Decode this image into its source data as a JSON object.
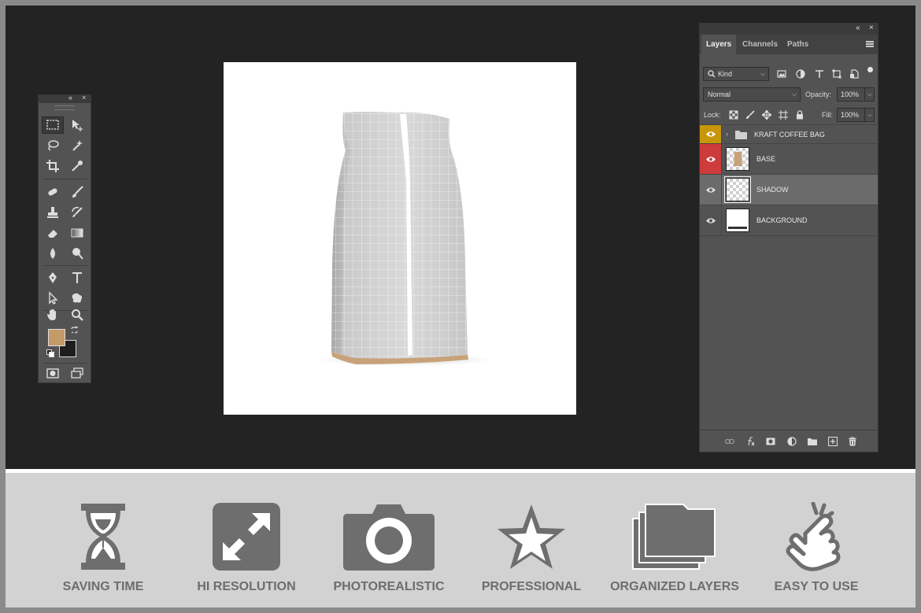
{
  "colors": {
    "workspace": "#232323",
    "panel": "#535353",
    "foreground_swatch": "#c49a66",
    "background_swatch": "#1e1e1e",
    "eye_group": "#c8960a",
    "eye_base": "#cd3b3b",
    "feature_icon": "#6e6e6e"
  },
  "tools_panel": {
    "collapse_glyph": "«",
    "close_glyph": "×"
  },
  "layers_panel": {
    "collapse_glyph": "«",
    "close_glyph": "×",
    "tabs": [
      "Layers",
      "Channels",
      "Paths"
    ],
    "filter": {
      "label": "Kind"
    },
    "blend_mode": "Normal",
    "opacity": {
      "label": "Opacity:",
      "value": "100%"
    },
    "lock": {
      "label": "Lock:"
    },
    "fill": {
      "label": "Fill:",
      "value": "100%"
    },
    "layers": [
      {
        "name": "KRAFT COFFEE BAG",
        "type": "group"
      },
      {
        "name": "BASE",
        "type": "layer"
      },
      {
        "name": "SHADOW",
        "type": "layer",
        "selected": true
      },
      {
        "name": "BACKGROUND",
        "type": "layer"
      }
    ]
  },
  "features": [
    {
      "label": "SAVING TIME",
      "icon": "hourglass-icon"
    },
    {
      "label": "HI RESOLUTION",
      "icon": "expand-icon"
    },
    {
      "label": "PHOTOREALISTIC",
      "icon": "camera-icon"
    },
    {
      "label": "PROFESSIONAL",
      "icon": "star-icon"
    },
    {
      "label": "ORGANIZED LAYERS",
      "icon": "folders-icon"
    },
    {
      "label": "EASY TO USE",
      "icon": "tap-hand-icon"
    }
  ]
}
